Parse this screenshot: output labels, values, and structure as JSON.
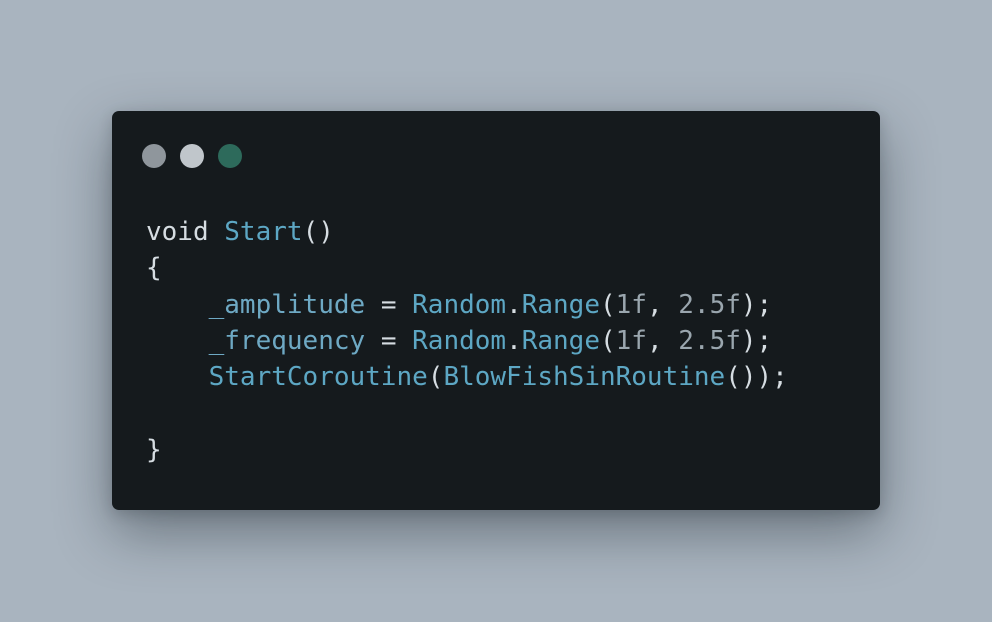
{
  "window": {
    "controls": [
      {
        "name": "window-dot-gray",
        "color": "#8f969c"
      },
      {
        "name": "window-dot-light",
        "color": "#c0c6cb"
      },
      {
        "name": "window-dot-green",
        "color": "#2d6a5b"
      }
    ]
  },
  "code": {
    "lines": [
      {
        "tokens": [
          {
            "text": "void",
            "type": "keyword"
          },
          {
            "text": " ",
            "type": "text"
          },
          {
            "text": "Start",
            "type": "function"
          },
          {
            "text": "()",
            "type": "punctuation"
          }
        ]
      },
      {
        "tokens": [
          {
            "text": "{",
            "type": "punctuation"
          }
        ]
      },
      {
        "tokens": [
          {
            "text": "    ",
            "type": "text"
          },
          {
            "text": "_amplitude",
            "type": "variable"
          },
          {
            "text": " = ",
            "type": "punctuation"
          },
          {
            "text": "Random",
            "type": "function"
          },
          {
            "text": ".",
            "type": "punctuation"
          },
          {
            "text": "Range",
            "type": "function"
          },
          {
            "text": "(",
            "type": "punctuation"
          },
          {
            "text": "1f",
            "type": "number"
          },
          {
            "text": ", ",
            "type": "punctuation"
          },
          {
            "text": "2.5f",
            "type": "number"
          },
          {
            "text": ");",
            "type": "punctuation"
          }
        ]
      },
      {
        "tokens": [
          {
            "text": "    ",
            "type": "text"
          },
          {
            "text": "_frequency",
            "type": "variable"
          },
          {
            "text": " = ",
            "type": "punctuation"
          },
          {
            "text": "Random",
            "type": "function"
          },
          {
            "text": ".",
            "type": "punctuation"
          },
          {
            "text": "Range",
            "type": "function"
          },
          {
            "text": "(",
            "type": "punctuation"
          },
          {
            "text": "1f",
            "type": "number"
          },
          {
            "text": ", ",
            "type": "punctuation"
          },
          {
            "text": "2.5f",
            "type": "number"
          },
          {
            "text": ");",
            "type": "punctuation"
          }
        ]
      },
      {
        "tokens": [
          {
            "text": "    ",
            "type": "text"
          },
          {
            "text": "StartCoroutine",
            "type": "function"
          },
          {
            "text": "(",
            "type": "punctuation"
          },
          {
            "text": "BlowFishSinRoutine",
            "type": "function"
          },
          {
            "text": "());",
            "type": "punctuation"
          }
        ]
      },
      {
        "tokens": [
          {
            "text": "",
            "type": "text"
          }
        ]
      },
      {
        "tokens": [
          {
            "text": "}",
            "type": "punctuation"
          }
        ]
      }
    ]
  }
}
